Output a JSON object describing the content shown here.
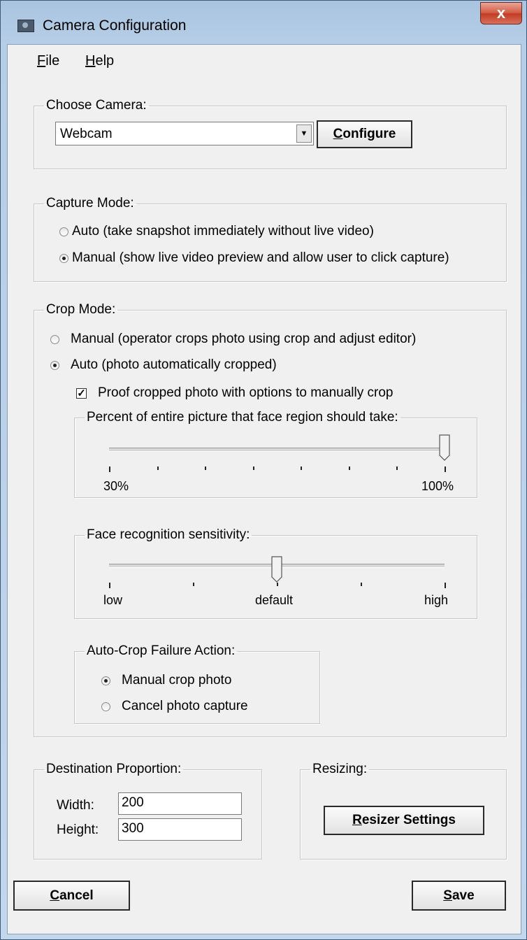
{
  "window": {
    "title": "Camera Configuration",
    "close_glyph": "x"
  },
  "menu": {
    "items": [
      {
        "label": "File",
        "accel": "F",
        "rest": "ile"
      },
      {
        "label": "Help",
        "accel": "H",
        "rest": "elp"
      }
    ]
  },
  "choose_camera": {
    "legend": "Choose Camera:",
    "selected": "Webcam",
    "configure_button": {
      "accel": "C",
      "rest": "onfigure"
    }
  },
  "capture_mode": {
    "legend": "Capture Mode:",
    "options": [
      {
        "label": "Auto (take snapshot immediately without live video)",
        "selected": false
      },
      {
        "label": "Manual (show live video preview and allow user to click capture)",
        "selected": true
      }
    ]
  },
  "crop_mode": {
    "legend": "Crop Mode:",
    "options": [
      {
        "label": "Manual (operator crops photo using crop and adjust editor)",
        "selected": false
      },
      {
        "label": "Auto (photo automatically cropped)",
        "selected": true
      }
    ],
    "proof": {
      "label": "Proof cropped photo with options to manually crop",
      "checked": true,
      "mark": "✓"
    },
    "face_percent": {
      "legend": "Percent of entire picture that face region should take:",
      "min_label": "30%",
      "max_label": "100%",
      "value_fraction": 1.0,
      "tick_count": 8
    },
    "sensitivity": {
      "legend": "Face recognition sensitivity:",
      "labels": {
        "low": "low",
        "default": "default",
        "high": "high"
      },
      "value_fraction": 0.5,
      "tick_count": 5
    },
    "failure": {
      "legend": "Auto-Crop Failure Action:",
      "options": [
        {
          "label": "Manual crop photo",
          "selected": true
        },
        {
          "label": "Cancel photo capture",
          "selected": false
        }
      ]
    }
  },
  "destination": {
    "legend": "Destination Proportion:",
    "width_label": "Width:",
    "width_value": "200",
    "height_label": "Height:",
    "height_value": "300"
  },
  "resizing": {
    "legend": "Resizing:",
    "button": {
      "accel": "R",
      "rest": "esizer Settings"
    }
  },
  "footer": {
    "cancel": {
      "accel": "C",
      "rest": "ancel"
    },
    "save": {
      "accel": "S",
      "rest": "ave"
    }
  }
}
